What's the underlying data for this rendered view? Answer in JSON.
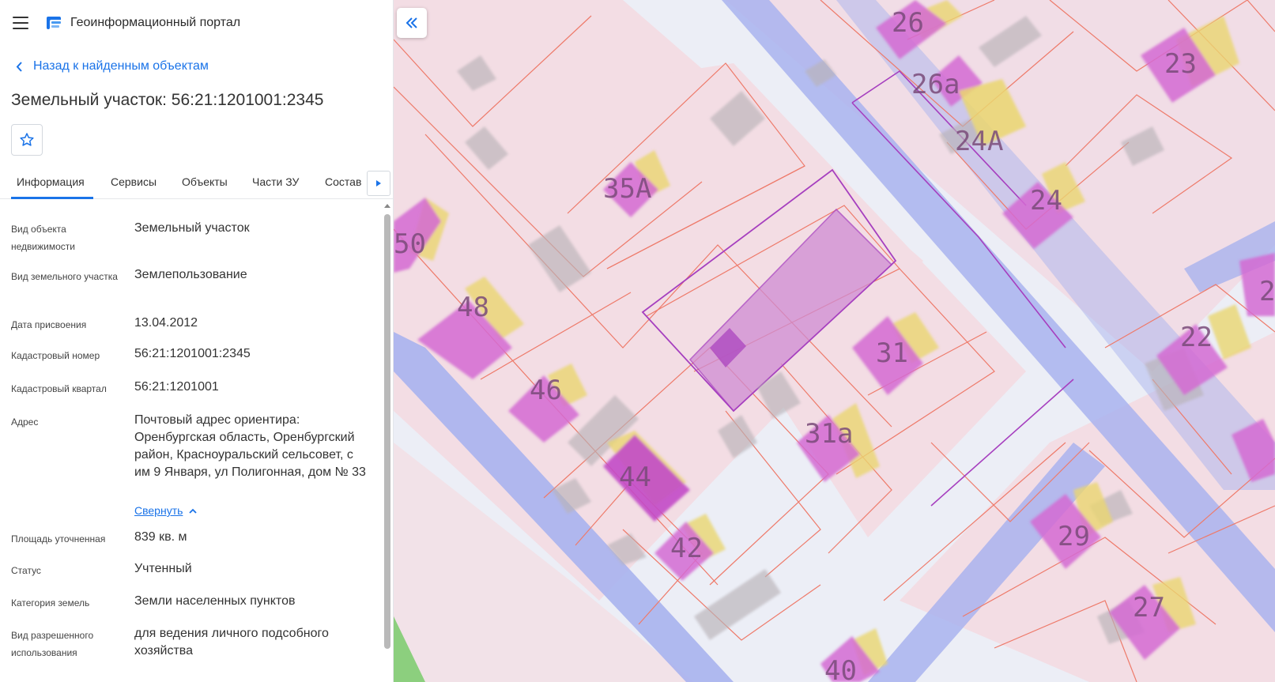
{
  "header": {
    "title": "Геоинформационный портал"
  },
  "back_link": {
    "label": "Назад к найденным объектам"
  },
  "object": {
    "title": "Земельный участок: 56:21:1201001:2345"
  },
  "tabs": [
    {
      "label": "Информация"
    },
    {
      "label": "Сервисы"
    },
    {
      "label": "Объекты"
    },
    {
      "label": "Части ЗУ"
    },
    {
      "label": "Состав"
    }
  ],
  "properties": [
    {
      "label": "Вид объекта недвижимости",
      "value": "Земельный участок"
    },
    {
      "label": "Вид земельного участка",
      "value": "Землепользование"
    },
    {
      "label": "Дата присвоения",
      "value": "13.04.2012"
    },
    {
      "label": "Кадастровый номер",
      "value": "56:21:1201001:2345"
    },
    {
      "label": "Кадастровый квартал",
      "value": "56:21:1201001"
    },
    {
      "label": "Адрес",
      "value": "Почтовый адрес ориентира: Оренбургская область, Оренбургский район, Красноуральский сельсовет, с им 9 Января, ул Полигонная, дом № 33"
    },
    {
      "label": "Площадь уточненная",
      "value": "839 кв. м"
    },
    {
      "label": "Статус",
      "value": "Учтенный"
    },
    {
      "label": "Категория земель",
      "value": "Земли населенных пунктов"
    },
    {
      "label": "Вид разрешенного использования",
      "value": "для ведения личного подсобного хозяйства"
    }
  ],
  "address_toggle": {
    "label": "Свернуть"
  },
  "map": {
    "building_numbers": [
      "26",
      "23",
      "26а",
      "24А",
      "35А",
      "24",
      "50",
      "48",
      "31",
      "22",
      "46",
      "31а",
      "44",
      "42",
      "29",
      "27",
      "40",
      "2"
    ],
    "colors": {
      "road": "#a9b3ee",
      "parcel_fill": "#f3dde4",
      "parcel_line": "#ee7a6a",
      "building": "#d46ad2",
      "building_shadow": "#ead66f",
      "selected_parcel": "#cf8cd3",
      "selected_line": "#a63fbf",
      "accent": "#1a73e8"
    }
  }
}
